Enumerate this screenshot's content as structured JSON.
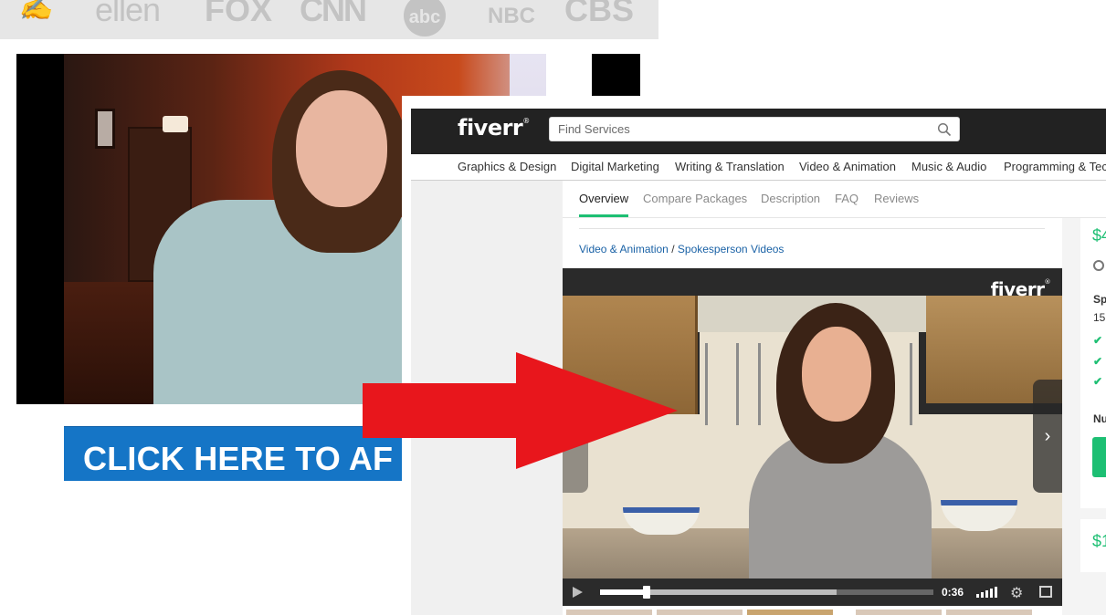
{
  "background_page": {
    "press_logos": [
      "ellen",
      "FOX",
      "CNN",
      "abc",
      "NBC",
      "CBS"
    ],
    "cta_label": "CLICK HERE TO AF"
  },
  "fiverr": {
    "logo": "fiverr",
    "search": {
      "placeholder": "Find Services"
    },
    "categories": [
      "Graphics & Design",
      "Digital Marketing",
      "Writing & Translation",
      "Video & Animation",
      "Music & Audio",
      "Programming & Tech"
    ],
    "tabs": [
      {
        "label": "Overview",
        "active": true
      },
      {
        "label": "Compare Packages",
        "active": false
      },
      {
        "label": "Description",
        "active": false
      },
      {
        "label": "FAQ",
        "active": false
      },
      {
        "label": "Reviews",
        "active": false
      }
    ],
    "breadcrumb": {
      "parent": "Video & Animation",
      "separator": "/",
      "current": "Spokesperson Videos"
    },
    "video": {
      "watermark": "fiverr",
      "time": "0:36",
      "progress_played": 0.14,
      "progress_buffered": 0.71
    },
    "package": {
      "price": "$4",
      "title_fragment": "Sp",
      "subtitle_fragment": "15",
      "label_fragment": "Nu"
    },
    "package2": {
      "price": "$1"
    }
  },
  "colors": {
    "fiverr_green": "#1dbf73",
    "cta_blue": "#1575c6",
    "arrow_red": "#e8161c",
    "topbar": "#222222",
    "link_blue": "#1a62a6"
  },
  "icons": [
    "search-icon",
    "play-icon",
    "volume-icon",
    "gear-icon",
    "fullscreen-icon",
    "chevron-right-icon",
    "clock-icon",
    "check-icon",
    "arrow-right-icon"
  ]
}
